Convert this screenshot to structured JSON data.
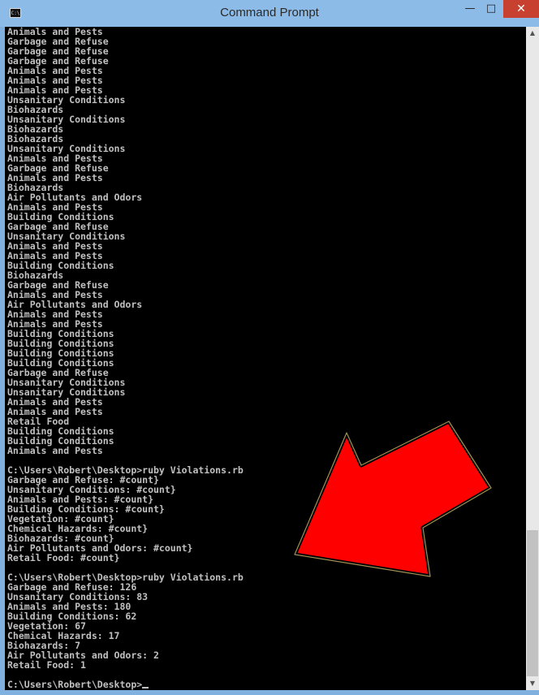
{
  "window": {
    "title": "Command Prompt",
    "icon_label": "C:\\",
    "min_glyph": "—",
    "max_glyph": "□",
    "close_glyph": "✕"
  },
  "console": {
    "lines": [
      "Animals and Pests",
      "Garbage and Refuse",
      "Garbage and Refuse",
      "Garbage and Refuse",
      "Animals and Pests",
      "Animals and Pests",
      "Animals and Pests",
      "Unsanitary Conditions",
      "Biohazards",
      "Unsanitary Conditions",
      "Biohazards",
      "Biohazards",
      "Unsanitary Conditions",
      "Animals and Pests",
      "Garbage and Refuse",
      "Animals and Pests",
      "Biohazards",
      "Air Pollutants and Odors",
      "Animals and Pests",
      "Building Conditions",
      "Garbage and Refuse",
      "Unsanitary Conditions",
      "Animals and Pests",
      "Animals and Pests",
      "Building Conditions",
      "Biohazards",
      "Garbage and Refuse",
      "Animals and Pests",
      "Air Pollutants and Odors",
      "Animals and Pests",
      "Animals and Pests",
      "Building Conditions",
      "Building Conditions",
      "Building Conditions",
      "Building Conditions",
      "Garbage and Refuse",
      "Unsanitary Conditions",
      "Unsanitary Conditions",
      "Animals and Pests",
      "Animals and Pests",
      "Retail Food",
      "Building Conditions",
      "Building Conditions",
      "Animals and Pests",
      "",
      "C:\\Users\\Robert\\Desktop>ruby Violations.rb",
      "Garbage and Refuse: #count}",
      "Unsanitary Conditions: #count}",
      "Animals and Pests: #count}",
      "Building Conditions: #count}",
      "Vegetation: #count}",
      "Chemical Hazards: #count}",
      "Biohazards: #count}",
      "Air Pollutants and Odors: #count}",
      "Retail Food: #count}",
      "",
      "C:\\Users\\Robert\\Desktop>ruby Violations.rb",
      "Garbage and Refuse: 126",
      "Unsanitary Conditions: 83",
      "Animals and Pests: 180",
      "Building Conditions: 62",
      "Vegetation: 67",
      "Chemical Hazards: 17",
      "Biohazards: 7",
      "Air Pollutants and Odors: 2",
      "Retail Food: 1",
      ""
    ],
    "prompt": "C:\\Users\\Robert\\Desktop>",
    "text_color": "#c0c0c0",
    "background_color": "#000000"
  },
  "annotation": {
    "arrow_color": "#ff0000"
  }
}
